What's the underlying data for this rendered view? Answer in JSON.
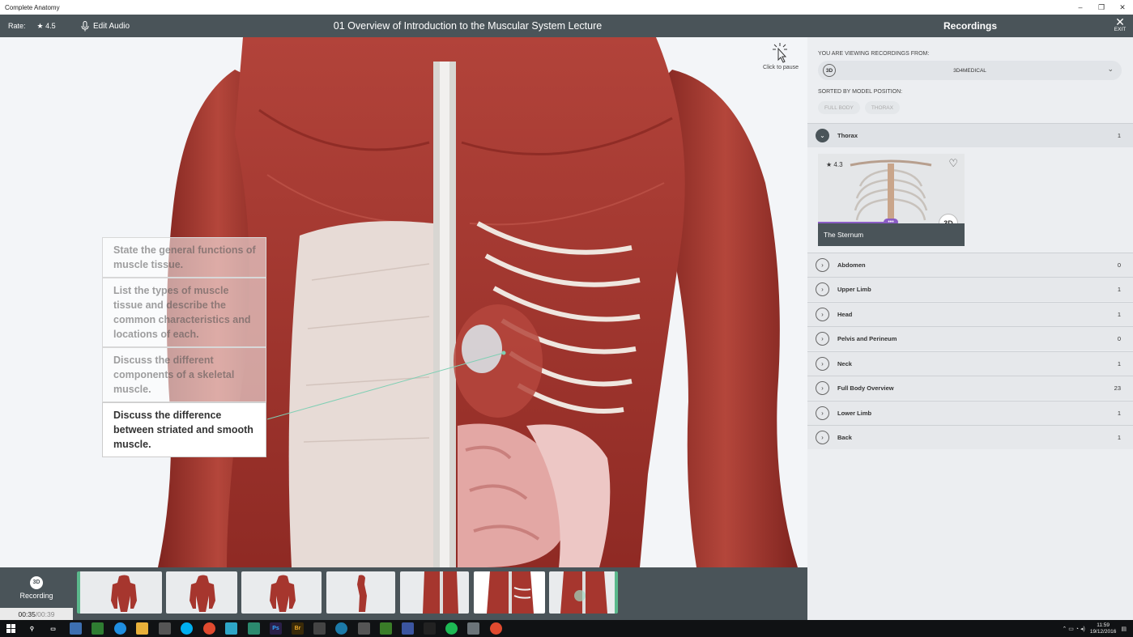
{
  "window": {
    "title": "Complete Anatomy",
    "minimize": "–",
    "maximize": "❐",
    "close": "✕"
  },
  "header": {
    "rate_label": "Rate:",
    "rate_value": "★ 4.5",
    "edit_audio": "Edit Audio",
    "lecture_title": "01 Overview of Introduction to the Muscular System Lecture",
    "panel_title": "Recordings",
    "exit_label": "EXIT"
  },
  "viewport": {
    "pause_label": "Click to pause",
    "objectives": [
      {
        "text": "State the general functions of muscle tissue.",
        "active": false
      },
      {
        "text": "List the types of muscle tissue and describe the common characteristics and locations of each.",
        "active": false
      },
      {
        "text": "Discuss the different components of a skeletal muscle.",
        "active": false
      },
      {
        "text": "Discuss the difference between striated and smooth muscle.",
        "active": true
      }
    ]
  },
  "timeline": {
    "recording_label": "Recording",
    "badge": "3D",
    "elapsed": "00:35",
    "total": "/00:39",
    "thumbnail_count": 7,
    "current_index": 5
  },
  "recordings": {
    "viewing_label": "YOU ARE VIEWING RECORDINGS FROM:",
    "source_badge": "3D",
    "source": "3D4MEDICAL",
    "sorted_label": "SORTED BY MODEL POSITION:",
    "sort_pills": [
      "FULL BODY",
      "THORAX"
    ],
    "sections": [
      {
        "label": "Thorax",
        "count": "1",
        "open": true
      },
      {
        "label": "Abdomen",
        "count": "0"
      },
      {
        "label": "Upper Limb",
        "count": "1"
      },
      {
        "label": "Head",
        "count": "1"
      },
      {
        "label": "Pelvis and Perineum",
        "count": "0"
      },
      {
        "label": "Neck",
        "count": "1"
      },
      {
        "label": "Full Body Overview",
        "count": "23"
      },
      {
        "label": "Lower Limb",
        "count": "1"
      },
      {
        "label": "Back",
        "count": "1"
      }
    ],
    "card": {
      "rating": "★ 4.3",
      "title": "The Sternum",
      "badge": "3D",
      "more": "•••"
    }
  },
  "taskbar": {
    "time": "11:59",
    "date": "19/12/2016"
  },
  "colors": {
    "header": "#4a5459",
    "muscle": "#a6362e",
    "accent_green": "#5bb98c",
    "accent_purple": "#8a5cc4"
  }
}
